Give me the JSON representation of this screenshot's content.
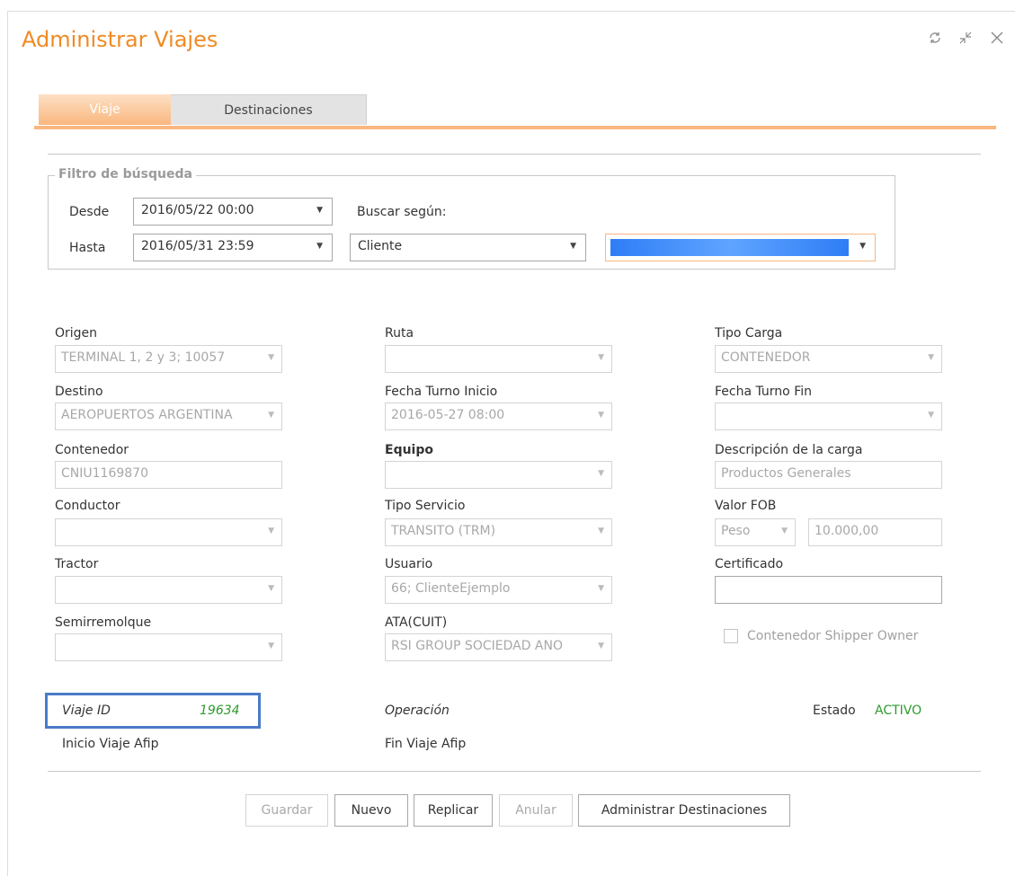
{
  "window": {
    "title": "Administrar Viajes",
    "refresh_icon": "refresh-icon",
    "collapse_icon": "collapse-icon",
    "close_icon": "close-icon"
  },
  "tabs": [
    {
      "label": "Viaje",
      "active": true
    },
    {
      "label": "Destinaciones",
      "active": false
    }
  ],
  "filter": {
    "legend": "Filtro de búsqueda",
    "desde_label": "Desde",
    "desde_value": "2016/05/22 00:00",
    "hasta_label": "Hasta",
    "hasta_value": "2016/05/31 23:59",
    "buscar_label": "Buscar según:",
    "buscar_value": "Cliente"
  },
  "fields": {
    "origen": {
      "label": "Origen",
      "value": "TERMINAL 1, 2 y 3; 10057"
    },
    "destino": {
      "label": "Destino",
      "value": "AEROPUERTOS ARGENTINA"
    },
    "contenedor": {
      "label": "Contenedor",
      "value": "CNIU1169870"
    },
    "conductor": {
      "label": "Conductor",
      "value": ""
    },
    "tractor": {
      "label": "Tractor",
      "value": ""
    },
    "semirremolque": {
      "label": "Semirremolque",
      "value": ""
    },
    "ruta": {
      "label": "Ruta",
      "value": ""
    },
    "fecha_inicio": {
      "label": "Fecha Turno Inicio",
      "value": "2016-05-27 08:00"
    },
    "equipo": {
      "label": "Equipo",
      "value": ""
    },
    "tipo_servicio": {
      "label": "Tipo Servicio",
      "value": "TRANSITO (TRM)"
    },
    "usuario": {
      "label": "Usuario",
      "value": "66; ClienteEjemplo"
    },
    "ata": {
      "label": "ATA(CUIT)",
      "value": "RSI GROUP SOCIEDAD ANO"
    },
    "tipo_carga": {
      "label": "Tipo Carga",
      "value": "CONTENEDOR"
    },
    "fecha_fin": {
      "label": "Fecha Turno Fin",
      "value": ""
    },
    "descripcion": {
      "label": "Descripción de la carga",
      "value": "Productos Generales"
    },
    "valor_fob": {
      "label": "Valor FOB",
      "currency": "Peso",
      "amount": "10.000,00"
    },
    "certificado": {
      "label": "Certificado",
      "value": ""
    },
    "shipper_owner": {
      "label": "Contenedor Shipper Owner",
      "checked": false
    }
  },
  "info": {
    "viaje_id_label": "Viaje ID",
    "viaje_id_value": "19634",
    "operacion_label": "Operación",
    "estado_label": "Estado",
    "estado_value": "ACTIVO",
    "inicio_afip_label": "Inicio Viaje Afip",
    "fin_afip_label": "Fin Viaje Afip"
  },
  "buttons": {
    "guardar": "Guardar",
    "nuevo": "Nuevo",
    "replicar": "Replicar",
    "anular": "Anular",
    "administrar": "Administrar Destinaciones"
  },
  "colors": {
    "accent": "#f08a24",
    "tab_active": "#f9b77f",
    "status_active": "#2e9b2e",
    "highlight_border": "#4a7cc7",
    "redacted_fill": "#2f7df6"
  }
}
